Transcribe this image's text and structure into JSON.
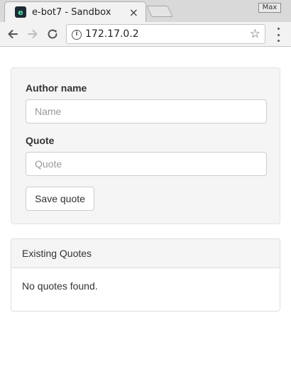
{
  "browser": {
    "tab_title": "e-bot7 - Sandbox",
    "favicon_glyph": "e",
    "close_glyph": "×",
    "window_button": "Max",
    "url": "172.17.0.2",
    "info_glyph": "i",
    "star_glyph": "☆"
  },
  "form": {
    "author_label": "Author name",
    "author_placeholder": "Name",
    "author_value": "",
    "quote_label": "Quote",
    "quote_placeholder": "Quote",
    "quote_value": "",
    "save_label": "Save quote"
  },
  "quotes_panel": {
    "heading": "Existing Quotes",
    "empty_message": "No quotes found."
  },
  "colors": {
    "favicon_bg": "#1c2b33",
    "favicon_fg": "#58e0b0",
    "well_bg": "#f5f5f5",
    "border": "#cccccc"
  },
  "icons": {
    "back": "arrow-left-icon",
    "forward": "arrow-right-icon",
    "reload": "reload-icon",
    "info": "info-icon",
    "bookmark": "star-icon",
    "menu": "kebab-menu-icon",
    "close": "close-icon"
  }
}
